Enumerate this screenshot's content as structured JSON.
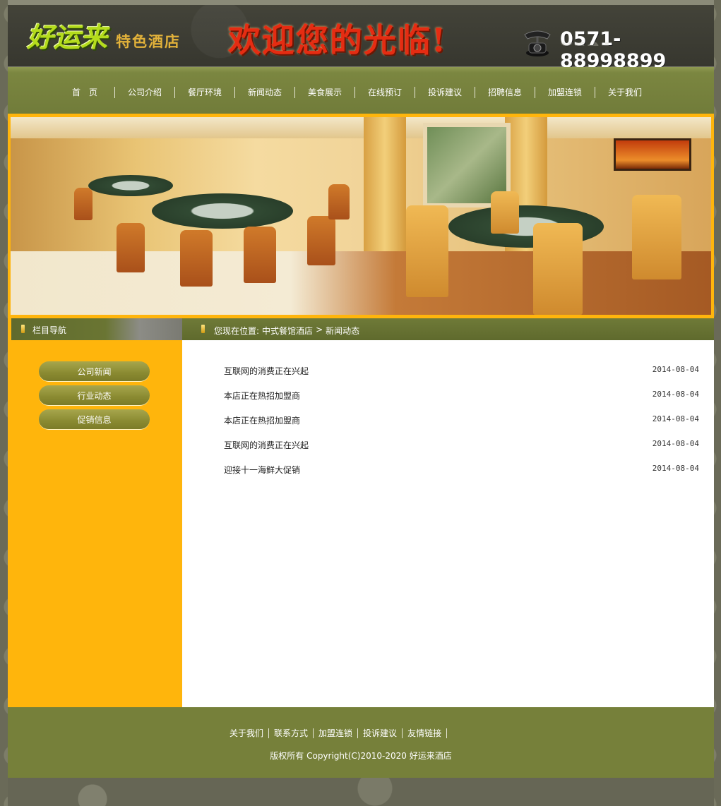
{
  "header": {
    "logo_main": "好运来",
    "logo_sub": "特色酒店",
    "welcome": "欢迎您的光临!",
    "phone": "0571-88998899"
  },
  "nav": {
    "items": [
      "首　页",
      "公司介绍",
      "餐厅环境",
      "新闻动态",
      "美食展示",
      "在线预订",
      "投诉建议",
      "招聘信息",
      "加盟连锁",
      "关于我们"
    ]
  },
  "sidebar": {
    "title": "栏目导航",
    "items": [
      "公司新闻",
      "行业动态",
      "促销信息"
    ]
  },
  "breadcrumb": {
    "prefix": "您现在位置:",
    "home": "中式餐馆酒店",
    "separator": ">",
    "current": "新闻动态"
  },
  "news": [
    {
      "title": "互联网的消费正在兴起",
      "date": "2014-08-04"
    },
    {
      "title": "本店正在热招加盟商",
      "date": "2014-08-04"
    },
    {
      "title": "本店正在热招加盟商",
      "date": "2014-08-04"
    },
    {
      "title": "互联网的消费正在兴起",
      "date": "2014-08-04"
    },
    {
      "title": "迎接十一海鲜大促销",
      "date": "2014-08-04"
    }
  ],
  "footer": {
    "links": [
      "关于我们",
      "联系方式",
      "加盟连锁",
      "投诉建议",
      "友情链接"
    ],
    "copyright": "版权所有 Copyright(C)2010-2020 好运来酒店"
  }
}
